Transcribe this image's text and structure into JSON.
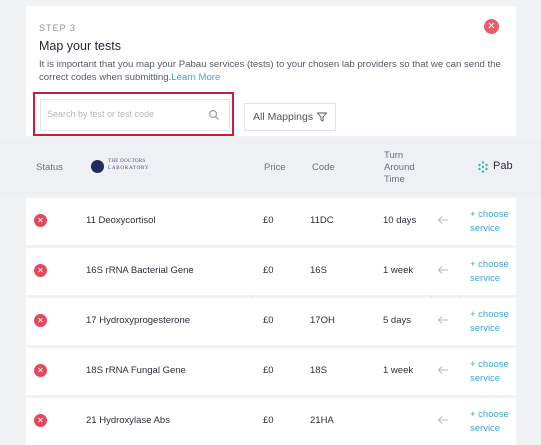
{
  "step": {
    "label": "STEP 3",
    "title": "Map your tests",
    "description": "It is important that you map your Pabau services (tests) to your chosen lab providers so that we can send the correct codes when submitting.",
    "learn_more": "Learn More",
    "close_icon": "x-icon"
  },
  "search": {
    "placeholder": "Search by test or test code",
    "value": ""
  },
  "filter": {
    "label": "All Mappings"
  },
  "table": {
    "headers": {
      "status": "Status",
      "lab_logo_line1": "THE DOCTORS",
      "lab_logo_line2": "LABORATORY",
      "price": "Price",
      "code": "Code",
      "turn_l1": "Turn",
      "turn_l2": "Around",
      "turn_l3": "Time",
      "pabau": "Pab"
    },
    "rows": [
      {
        "name": "11 Deoxycortisol",
        "price": "£0",
        "code": "11DC",
        "turn": "10 days",
        "choose_l1": "+ choose",
        "choose_l2": "service"
      },
      {
        "name": "16S rRNA Bacterial Gene",
        "price": "£0",
        "code": "16S",
        "turn": "1 week",
        "choose_l1": "+ choose",
        "choose_l2": "service"
      },
      {
        "name": "17 Hydroxyprogesterone",
        "price": "£0",
        "code": "17OH",
        "turn": "5 days",
        "choose_l1": "+ choose",
        "choose_l2": "service"
      },
      {
        "name": "18S rRNA Fungal Gene",
        "price": "£0",
        "code": "18S",
        "turn": "1 week",
        "choose_l1": "+ choose",
        "choose_l2": "service"
      },
      {
        "name": "21 Hydroxylase Abs",
        "price": "£0",
        "code": "21HA",
        "turn": "",
        "choose_l1": "+ choose",
        "choose_l2": "service"
      }
    ]
  },
  "colors": {
    "accent": "#3aa6d8",
    "error": "#e6485b",
    "highlight": "#c8203a"
  }
}
